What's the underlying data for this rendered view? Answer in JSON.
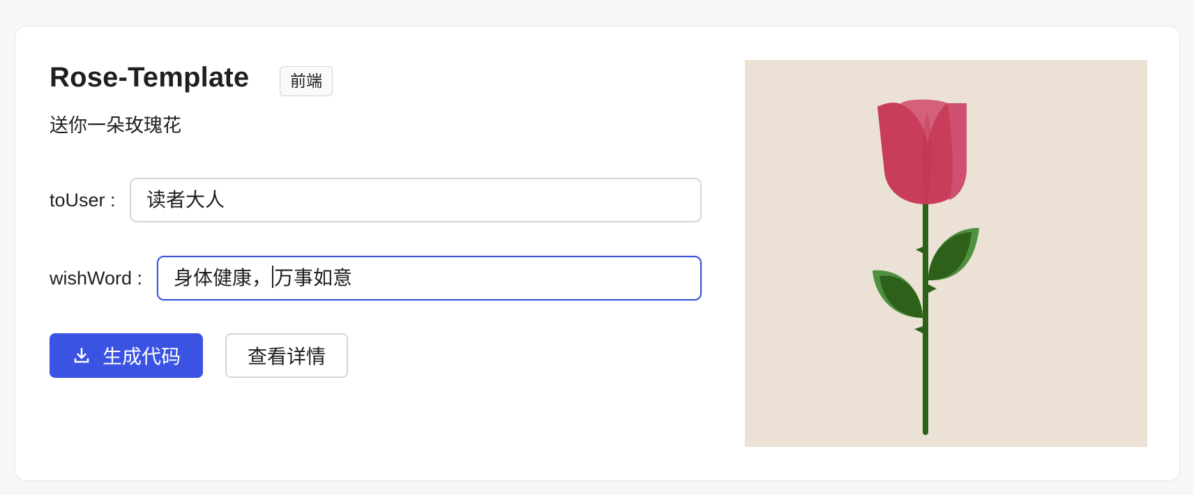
{
  "template": {
    "title": "Rose-Template",
    "tag": "前端",
    "description": "送你一朵玫瑰花"
  },
  "form": {
    "to_user": {
      "label": "toUser :",
      "value": "读者大人"
    },
    "wish_word": {
      "label": "wishWord :",
      "value_before_caret": "身体健康，",
      "value_after_caret": "万事如意"
    }
  },
  "actions": {
    "generate_label": "生成代码",
    "details_label": "查看详情"
  },
  "icons": {
    "generate": "download-icon",
    "preview": "rose-illustration"
  },
  "colors": {
    "primary": "#3a53e2",
    "focus_border": "#3a53d8",
    "preview_background": "#ebe2d5",
    "petal": "#c83e5a",
    "stem": "#2d6119",
    "leaf_light": "#4f9140"
  }
}
